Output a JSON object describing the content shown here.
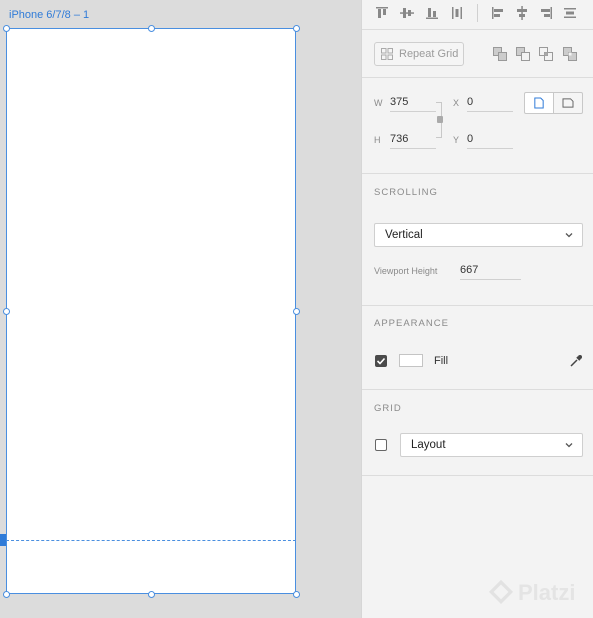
{
  "artboard": {
    "title": "iPhone 6/7/8 – 1"
  },
  "toolbar": {
    "align_icons": [
      "align-top-icon",
      "align-middle-icon",
      "align-bottom-icon",
      "distribute-vertical-icon"
    ],
    "align_h_icons": [
      "align-left-icon",
      "align-center-icon",
      "align-right-icon",
      "distribute-horizontal-icon"
    ]
  },
  "repeat_grid": {
    "label": "Repeat Grid"
  },
  "boolean_ops": [
    "union-icon",
    "subtract-icon",
    "intersect-icon",
    "exclude-icon"
  ],
  "dimensions": {
    "w_label": "W",
    "w_value": "375",
    "h_label": "H",
    "h_value": "736",
    "x_label": "X",
    "x_value": "0",
    "y_label": "Y",
    "y_value": "0"
  },
  "scrolling": {
    "title": "SCROLLING",
    "selected": "Vertical",
    "viewport_label": "Viewport Height",
    "viewport_value": "667"
  },
  "appearance": {
    "title": "APPEARANCE",
    "fill_label": "Fill",
    "fill_checked": true,
    "fill_color": "#ffffff"
  },
  "grid": {
    "title": "GRID",
    "checked": false,
    "selected": "Layout"
  },
  "watermark": {
    "text": "Platzi"
  },
  "colors": {
    "accent": "#2f7bd8",
    "panel_bg": "#f3f3f3",
    "canvas_bg": "#dcdcdc"
  }
}
